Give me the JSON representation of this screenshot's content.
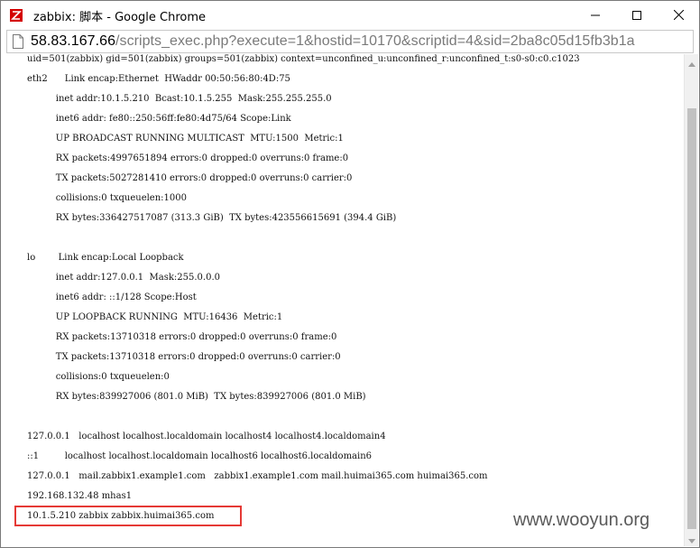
{
  "window": {
    "title": "zabbix: 脚本 - Google Chrome",
    "icon": "zabbix-logo-icon"
  },
  "controls": {
    "minimize": "minimize-icon",
    "maximize": "maximize-icon",
    "close": "close-icon"
  },
  "address_bar": {
    "host": "58.83.167.66",
    "path": "/scripts_exec.php?execute=1&hostid=10170&scriptid=4&sid=2ba8c05d15fb3b1a"
  },
  "output_lines": [
    {
      "text": "uid=501(zabbix) gid=501(zabbix) groups=501(zabbix) context=unconfined_u:unconfined_r:unconfined_t:s0-s0:c0.c1023"
    },
    {
      "text": "eth2      Link encap:Ethernet  HWaddr 00:50:56:80:4D:75"
    },
    {
      "text": "          inet addr:10.1.5.210  Bcast:10.1.5.255  Mask:255.255.255.0"
    },
    {
      "text": "          inet6 addr: fe80::250:56ff:fe80:4d75/64 Scope:Link"
    },
    {
      "text": "          UP BROADCAST RUNNING MULTICAST  MTU:1500  Metric:1"
    },
    {
      "text": "          RX packets:4997651894 errors:0 dropped:0 overruns:0 frame:0"
    },
    {
      "text": "          TX packets:5027281410 errors:0 dropped:0 overruns:0 carrier:0"
    },
    {
      "text": "          collisions:0 txqueuelen:1000"
    },
    {
      "text": "          RX bytes:336427517087 (313.3 GiB)  TX bytes:423556615691 (394.4 GiB)"
    },
    {
      "text": ""
    },
    {
      "text": "lo        Link encap:Local Loopback"
    },
    {
      "text": "          inet addr:127.0.0.1  Mask:255.0.0.0"
    },
    {
      "text": "          inet6 addr: ::1/128 Scope:Host"
    },
    {
      "text": "          UP LOOPBACK RUNNING  MTU:16436  Metric:1"
    },
    {
      "text": "          RX packets:13710318 errors:0 dropped:0 overruns:0 frame:0"
    },
    {
      "text": "          TX packets:13710318 errors:0 dropped:0 overruns:0 carrier:0"
    },
    {
      "text": "          collisions:0 txqueuelen:0"
    },
    {
      "text": "          RX bytes:839927006 (801.0 MiB)  TX bytes:839927006 (801.0 MiB)"
    },
    {
      "text": ""
    },
    {
      "text": "127.0.0.1   localhost localhost.localdomain localhost4 localhost4.localdomain4"
    },
    {
      "text": "::1         localhost localhost.localdomain localhost6 localhost6.localdomain6"
    },
    {
      "text": "127.0.0.1   mail.zabbix1.example1.com   zabbix1.example1.com mail.huimai365.com huimai365.com"
    },
    {
      "text": "192.168.132.48 mhas1"
    },
    {
      "text": "10.1.5.210 zabbix zabbix.huimai365.com"
    }
  ],
  "watermark": "www.wooyun.org",
  "colors": {
    "highlight": "#e53935",
    "url_path": "#7a7a7a"
  }
}
